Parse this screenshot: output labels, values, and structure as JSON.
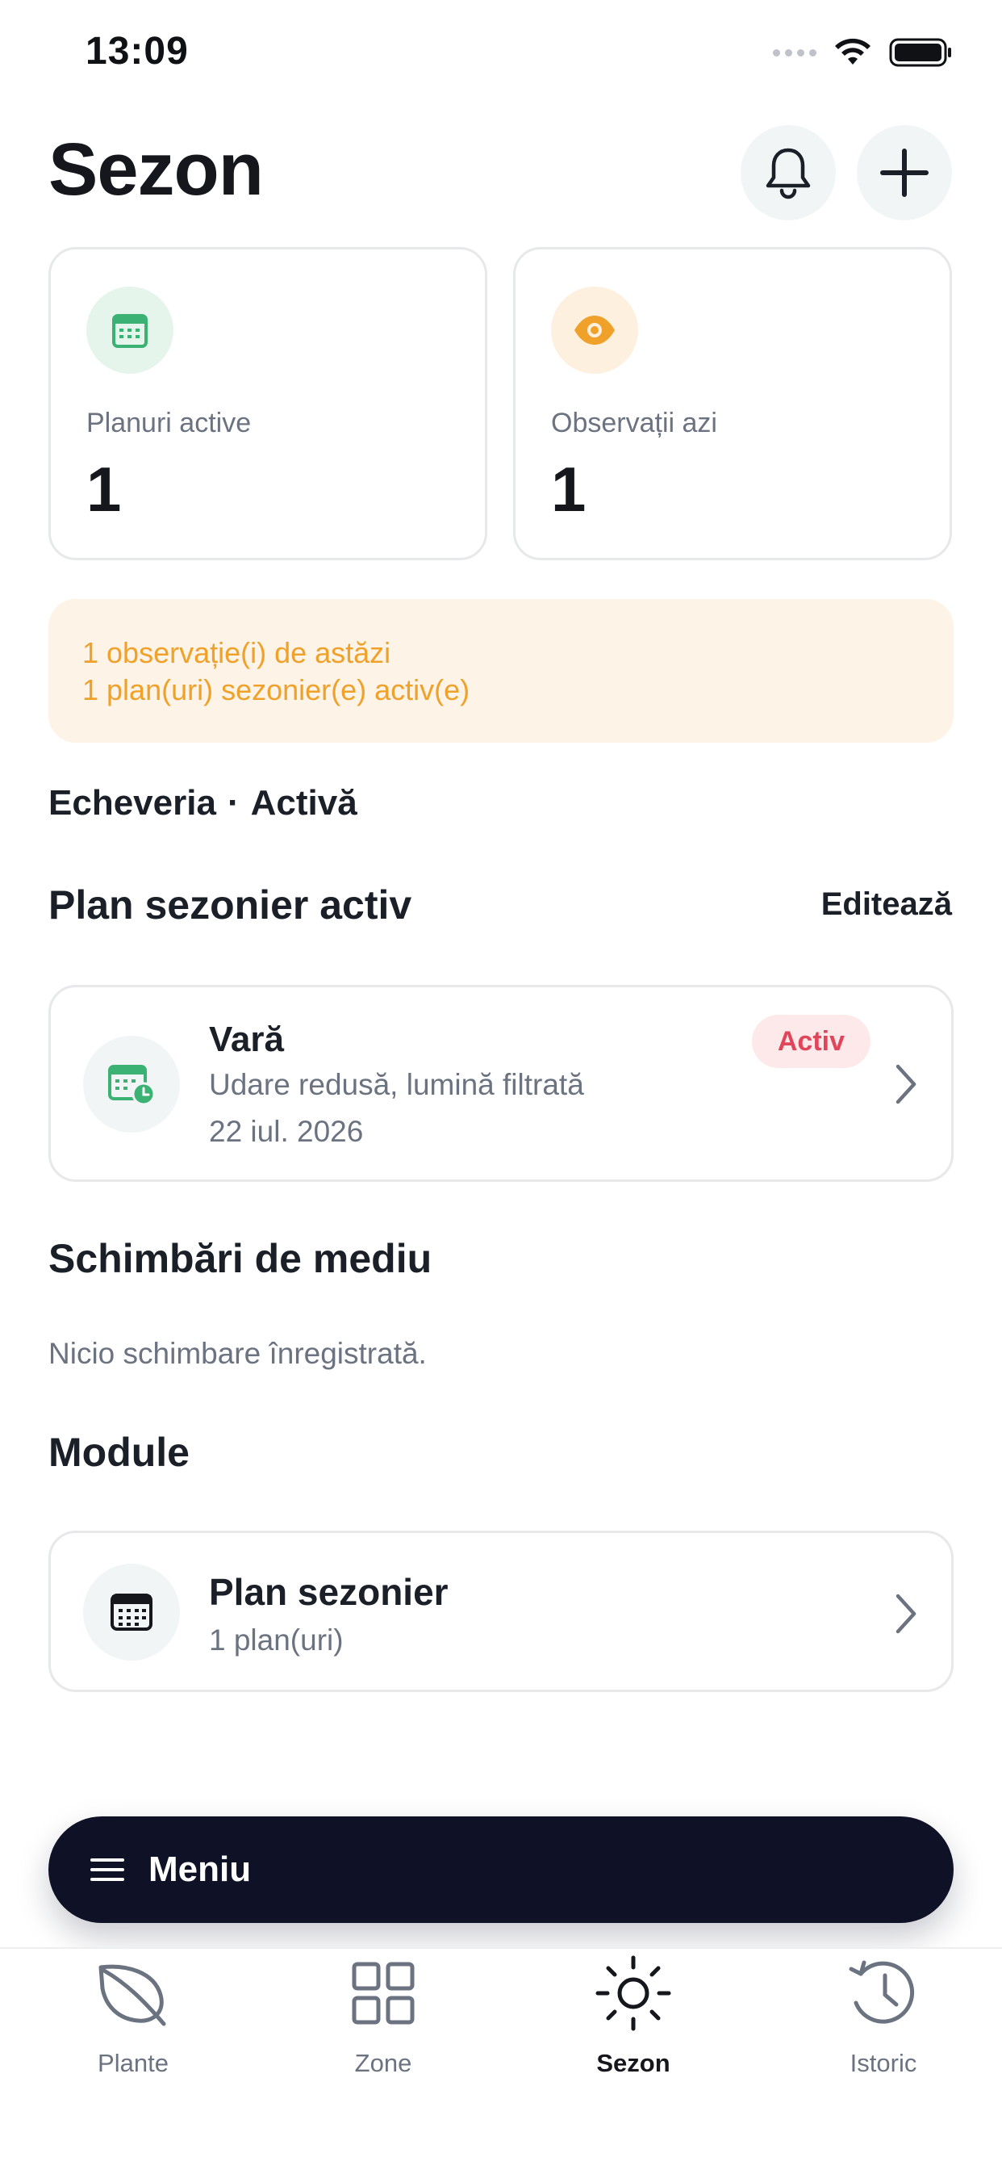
{
  "status_bar": {
    "time": "13:09"
  },
  "header": {
    "title": "Sezon"
  },
  "stats": [
    {
      "label": "Planuri active",
      "value": "1",
      "icon": "calendar-icon",
      "color": "#3bb273"
    },
    {
      "label": "Observații azi",
      "value": "1",
      "icon": "eye-icon",
      "color": "#f0a12a"
    }
  ],
  "alert": {
    "line1": "1 observație(i) de astăzi",
    "line2": "1 plan(uri) sezonier(e) activ(e)"
  },
  "plant": {
    "name": "Echeveria",
    "separator": "·",
    "status": "Activă"
  },
  "active_plan_section": {
    "title": "Plan sezonier activ",
    "edit_label": "Editează",
    "card": {
      "title": "Vară",
      "subtitle": "Udare redusă, lumină filtrată",
      "date": "22 iul. 2026",
      "badge": "Activ"
    }
  },
  "environment_section": {
    "title": "Schimbări de mediu",
    "empty_text": "Nicio schimbare înregistrată."
  },
  "modules_section": {
    "title": "Module",
    "card": {
      "title": "Plan sezonier",
      "subtitle": "1 plan(uri)"
    }
  },
  "menu": {
    "label": "Meniu"
  },
  "tabs": [
    {
      "label": "Plante",
      "icon": "leaf-icon"
    },
    {
      "label": "Zone",
      "icon": "grid-icon"
    },
    {
      "label": "Sezon",
      "icon": "sun-icon",
      "active": true
    },
    {
      "label": "Istoric",
      "icon": "history-icon"
    }
  ]
}
